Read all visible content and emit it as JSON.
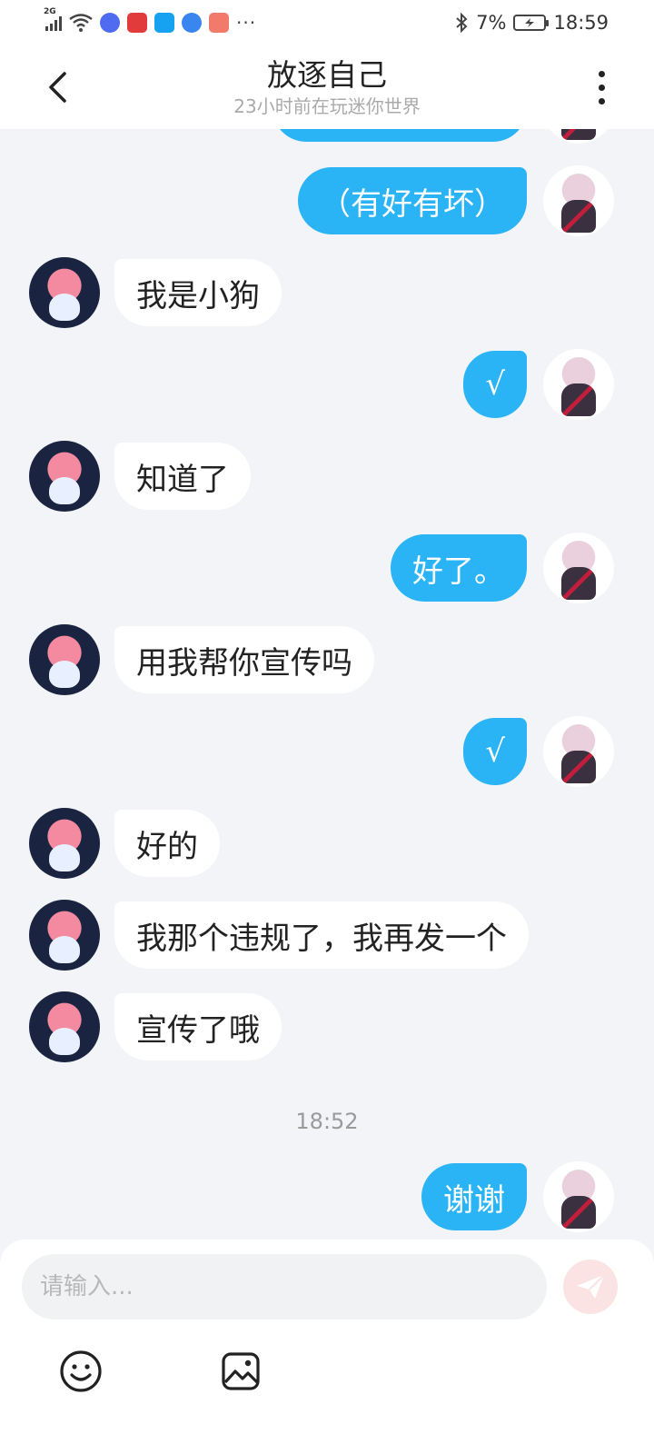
{
  "status_bar": {
    "network": "2G",
    "battery_percent": "7%",
    "time": "18:59",
    "overflow": "···",
    "app_icon_colors": [
      "#4f6cf0",
      "#e23b3b",
      "#16a2f0",
      "#3a86f0",
      "#f27a6a"
    ]
  },
  "header": {
    "title": "放逐自己",
    "subtitle": "23小时前在玩迷你世界"
  },
  "messages": [
    {
      "from": "me",
      "text": "（有好有坏）"
    },
    {
      "from": "other",
      "text": "我是小狗"
    },
    {
      "from": "me",
      "text": "√"
    },
    {
      "from": "other",
      "text": "知道了"
    },
    {
      "from": "me",
      "text": "好了。"
    },
    {
      "from": "other",
      "text": "用我帮你宣传吗"
    },
    {
      "from": "me",
      "text": "√"
    },
    {
      "from": "other",
      "text": "好的"
    },
    {
      "from": "other",
      "text": "我那个违规了，我再发一个"
    },
    {
      "from": "other",
      "text": "宣传了哦"
    },
    {
      "from": "me",
      "text": "谢谢"
    }
  ],
  "timestamp": "18:52",
  "composer": {
    "placeholder": "请输入..."
  },
  "colors": {
    "my_bubble": "#2ab4f5",
    "other_bubble": "#ffffff",
    "background": "#f2f4f7",
    "send_button": "#fbe3e3"
  },
  "icons": {
    "back": "back-arrow-icon",
    "more": "more-vertical-icon",
    "send": "send-icon",
    "emoji": "emoji-icon",
    "image": "image-icon"
  }
}
